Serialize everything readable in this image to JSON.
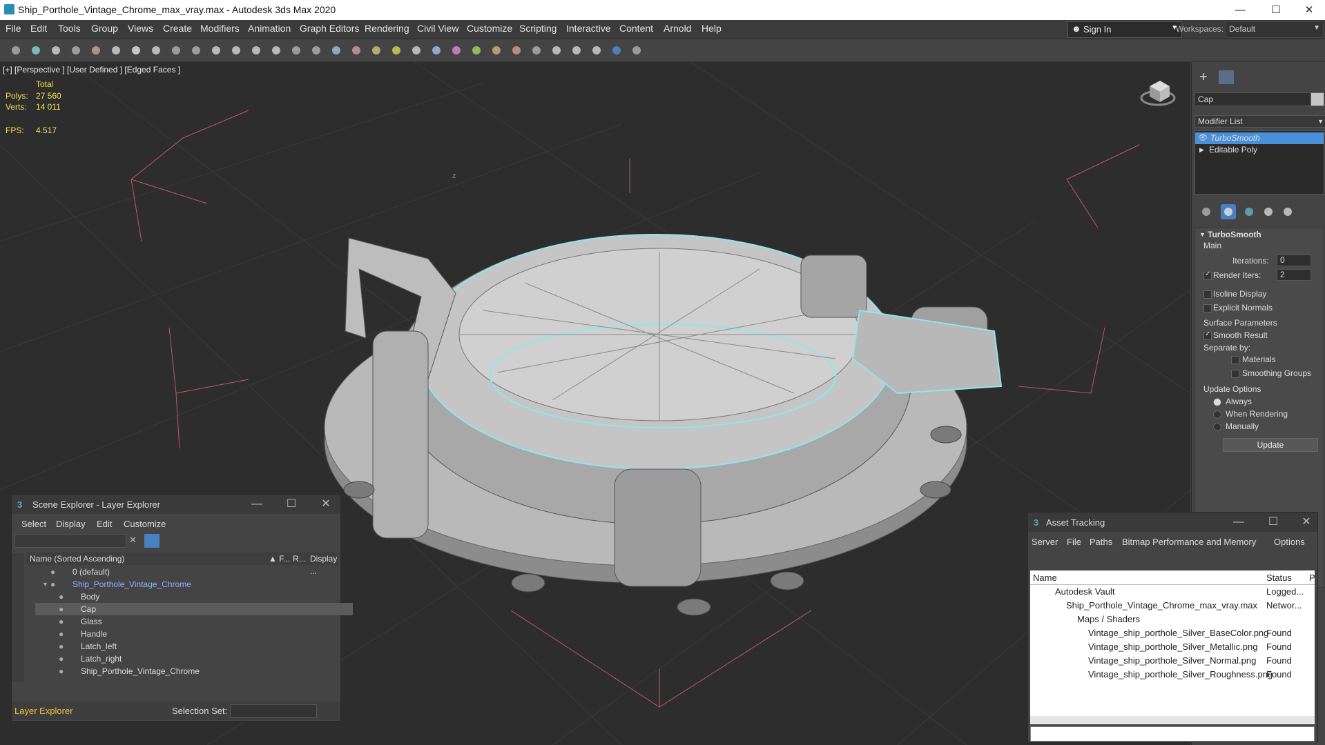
{
  "app": {
    "title": "Ship_Porthole_Vintage_Chrome_max_vray.max - Autodesk 3ds Max 2020",
    "window_controls": {
      "minimize": "—",
      "maximize": "☐",
      "close": "✕"
    }
  },
  "menu": [
    "File",
    "Edit",
    "Tools",
    "Group",
    "Views",
    "Create",
    "Modifiers",
    "Animation",
    "Graph Editors",
    "Rendering",
    "Civil View",
    "Customize",
    "Scripting",
    "Interactive",
    "Content",
    "Arnold",
    "Help"
  ],
  "signin": {
    "label": "Sign In"
  },
  "workspace": {
    "label": "Workspaces:",
    "value": "Default"
  },
  "toolbar": {
    "icons": [
      "undo-icon",
      "redo-icon",
      "link-icon",
      "unlink-icon",
      "bind-space-warp-icon",
      "selection-filter-icon",
      "select-object-icon",
      "select-by-name-icon",
      "rect-region-icon",
      "window-crossing-icon",
      "move-icon",
      "rotate-icon",
      "scale-icon",
      "place-icon",
      "ref-coord-icon",
      "pivot-icon",
      "snaps-icon",
      "angle-snap-icon",
      "percent-snap-icon",
      "spinner-snap-icon",
      "named-selection-icon",
      "mirror-icon",
      "align-icon",
      "layer-manager-icon",
      "toggle-ribbon-icon",
      "curve-editor-icon",
      "schematic-view-icon",
      "material-editor-icon",
      "render-setup-icon",
      "rendered-frame-icon",
      "render-icon",
      "help-icon"
    ]
  },
  "viewport": {
    "label": "[+] [Perspective ] [User Defined ] [Edged Faces ]",
    "stats": {
      "total_label": "Total",
      "polys_label": "Polys:",
      "polys": "27 560",
      "verts_label": "Verts:",
      "verts": "14 011",
      "fps_label": "FPS:",
      "fps": "4.517"
    }
  },
  "command_panel": {
    "object_name": "Cap",
    "modifier_list": "Modifier List",
    "stack": [
      "TurboSmooth",
      "Editable Poly"
    ],
    "rollout_title": "TurboSmooth",
    "main_label": "Main",
    "iterations_label": "Iterations:",
    "iterations": "0",
    "render_iters_label": "Render Iters:",
    "render_iters": "2",
    "isoline_label": "Isoline Display",
    "explicit_normals_label": "Explicit Normals",
    "surface_params_label": "Surface Parameters",
    "smooth_result_label": "Smooth Result",
    "separate_by_label": "Separate by:",
    "materials_label": "Materials",
    "smoothing_groups_label": "Smoothing Groups",
    "update_options_label": "Update Options",
    "always_label": "Always",
    "when_rendering_label": "When Rendering",
    "manually_label": "Manually",
    "update_button": "Update"
  },
  "scene_explorer": {
    "title": "Scene Explorer - Layer Explorer",
    "menu": [
      "Select",
      "Display",
      "Edit",
      "Customize"
    ],
    "columns": {
      "name": "Name (Sorted Ascending)",
      "f": "▲ F...",
      "r": "R...",
      "display": "Display ..."
    },
    "rows": [
      "0 (default)",
      "Ship_Porthole_Vintage_Chrome",
      "Body",
      "Cap",
      "Glass",
      "Handle",
      "Latch_left",
      "Latch_right",
      "Ship_Porthole_Vintage_Chrome"
    ],
    "footer_label": "Layer Explorer",
    "selection_set_label": "Selection Set:"
  },
  "asset_tracking": {
    "title": "Asset Tracking",
    "menu": [
      "Server",
      "File",
      "Paths",
      "Bitmap Performance and Memory",
      "Options"
    ],
    "columns": {
      "name": "Name",
      "status": "Status",
      "extra": "P"
    },
    "rows": [
      {
        "name": "Autodesk Vault",
        "status": "Logged..."
      },
      {
        "name": "Ship_Porthole_Vintage_Chrome_max_vray.max",
        "status": "Networ..."
      },
      {
        "name": "Maps / Shaders",
        "status": ""
      },
      {
        "name": "Vintage_ship_porthole_Silver_BaseColor.png",
        "status": "Found"
      },
      {
        "name": "Vintage_ship_porthole_Silver_Metallic.png",
        "status": "Found"
      },
      {
        "name": "Vintage_ship_porthole_Silver_Normal.png",
        "status": "Found"
      },
      {
        "name": "Vintage_ship_porthole_Silver_Roughness.png",
        "status": "Found"
      }
    ]
  },
  "colors": {
    "accent": "#4a90d9",
    "selection_outline": "#8fe6f0",
    "stats": "#f0e050"
  }
}
